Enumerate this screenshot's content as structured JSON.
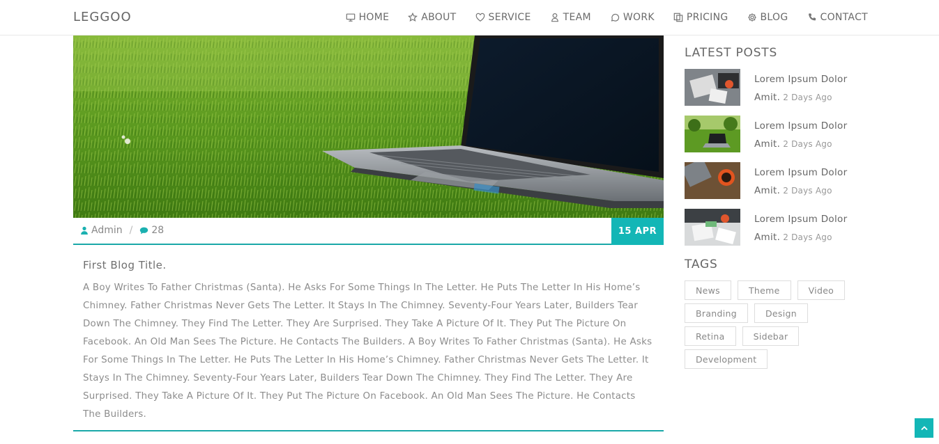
{
  "brand": "LEGGOO",
  "nav": [
    {
      "label": "HOME",
      "icon": "monitor-icon"
    },
    {
      "label": "ABOUT",
      "icon": "star-icon"
    },
    {
      "label": "SERVICE",
      "icon": "heart-icon"
    },
    {
      "label": "TEAM",
      "icon": "user-icon"
    },
    {
      "label": "WORK",
      "icon": "chat-bubble-icon"
    },
    {
      "label": "PRICING",
      "icon": "copy-icon"
    },
    {
      "label": "BLOG",
      "icon": "gear-icon"
    },
    {
      "label": "CONTACT",
      "icon": "phone-icon"
    }
  ],
  "post": {
    "author": "Admin",
    "separator": "/",
    "comments": "28",
    "date": "15 APR",
    "title": "First Blog Title.",
    "body": "A Boy Writes To Father Christmas (Santa). He Asks For Some Things In The Letter. He Puts The Letter In His Home’s Chimney. Father Christmas Never Gets The Letter. It Stays In The Chimney. Seventy-Four Years Later, Builders Tear Down The Chimney. They Find The Letter. They Are Surprised. They Take A Picture Of It. They Put The Picture On Facebook. An Old Man Sees The Picture. He Contacts The Builders. A Boy Writes To Father Christmas (Santa). He Asks For Some Things In The Letter. He Puts The Letter In His Home’s Chimney. Father Christmas Never Gets The Letter. It Stays In The Chimney. Seventy-Four Years Later, Builders Tear Down The Chimney. They Find The Letter. They Are Surprised. They Take A Picture Of It. They Put The Picture On Facebook. An Old Man Sees The Picture. He Contacts The Builders."
  },
  "sidebar": {
    "latest_title": "LATEST POSTS",
    "latest": [
      {
        "title": "Lorem Ipsum Dolor",
        "title2": "Amit.",
        "date": "2 Days Ago"
      },
      {
        "title": "Lorem Ipsum Dolor",
        "title2": "Amit.",
        "date": "2 Days Ago"
      },
      {
        "title": "Lorem Ipsum Dolor",
        "title2": "Amit.",
        "date": "2 Days Ago"
      },
      {
        "title": "Lorem Ipsum Dolor",
        "title2": "Amit.",
        "date": "2 Days Ago"
      }
    ],
    "tags_title": "TAGS",
    "tags": [
      "News",
      "Theme",
      "Video",
      "Branding",
      "Design",
      "Retina",
      "Sidebar",
      "Development"
    ]
  },
  "colors": {
    "accent": "#13b6b6",
    "text": "#8c8c8c"
  }
}
